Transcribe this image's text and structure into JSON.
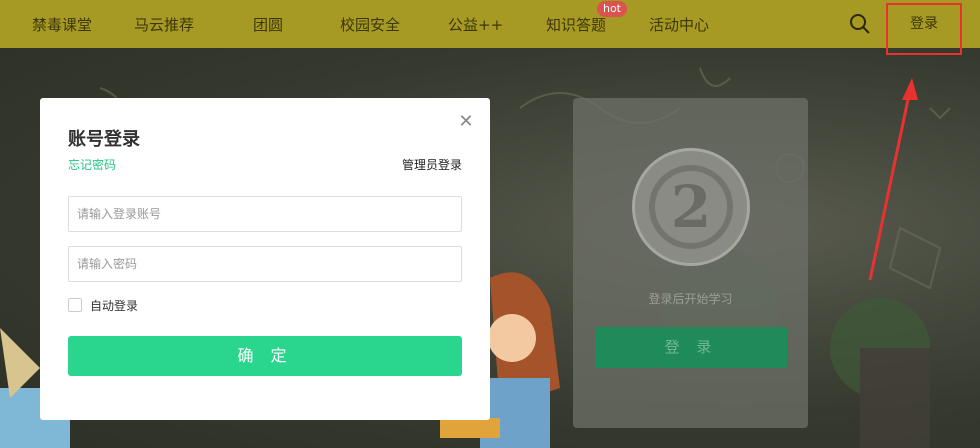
{
  "nav": {
    "items": [
      {
        "label": "禁毒课堂"
      },
      {
        "label": "马云推荐"
      },
      {
        "label": "团圆"
      },
      {
        "label": "校园安全"
      },
      {
        "label": "公益++"
      },
      {
        "label": "知识答题",
        "badge": "hot"
      },
      {
        "label": "活动中心"
      }
    ],
    "search_icon": "search-icon",
    "login_label": "登录",
    "bar_color": "#a79a24"
  },
  "side_panel": {
    "avatar_digit": "2",
    "hint": "登录后开始学习",
    "login_button": "登 录"
  },
  "login_modal": {
    "title": "账号登录",
    "forgot_password": "忘记密码",
    "admin_login": "管理员登录",
    "account_placeholder": "请输入登录账号",
    "account_value": "",
    "password_placeholder": "请输入密码",
    "password_value": "",
    "auto_login_label": "自动登录",
    "auto_login_checked": false,
    "confirm_button": "确 定",
    "close_icon": "close-icon",
    "accent_color": "#2ad58e"
  }
}
